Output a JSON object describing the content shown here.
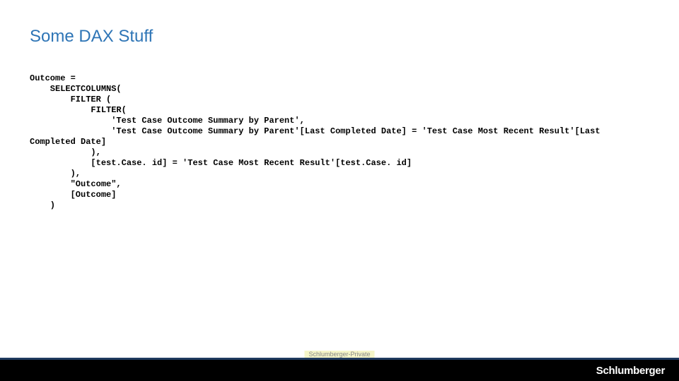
{
  "title": "Some DAX Stuff",
  "code": {
    "l1": "Outcome =",
    "l2": "    SELECTCOLUMNS(",
    "l3": "        FILTER (",
    "l4": "            FILTER(",
    "l5": "                'Test Case Outcome Summary by Parent',",
    "l6": "                'Test Case Outcome Summary by Parent'[Last Completed Date] = 'Test Case Most Recent Result'[Last",
    "l7": "Completed Date]",
    "l8": "            ),",
    "l9": "            [test.Case. id] = 'Test Case Most Recent Result'[test.Case. id]",
    "l10": "        ),",
    "l11": "        \"Outcome\",",
    "l12": "        [Outcome]",
    "l13": "    )"
  },
  "classification": "Schlumberger-Private",
  "logo_text": "Schlumberger"
}
